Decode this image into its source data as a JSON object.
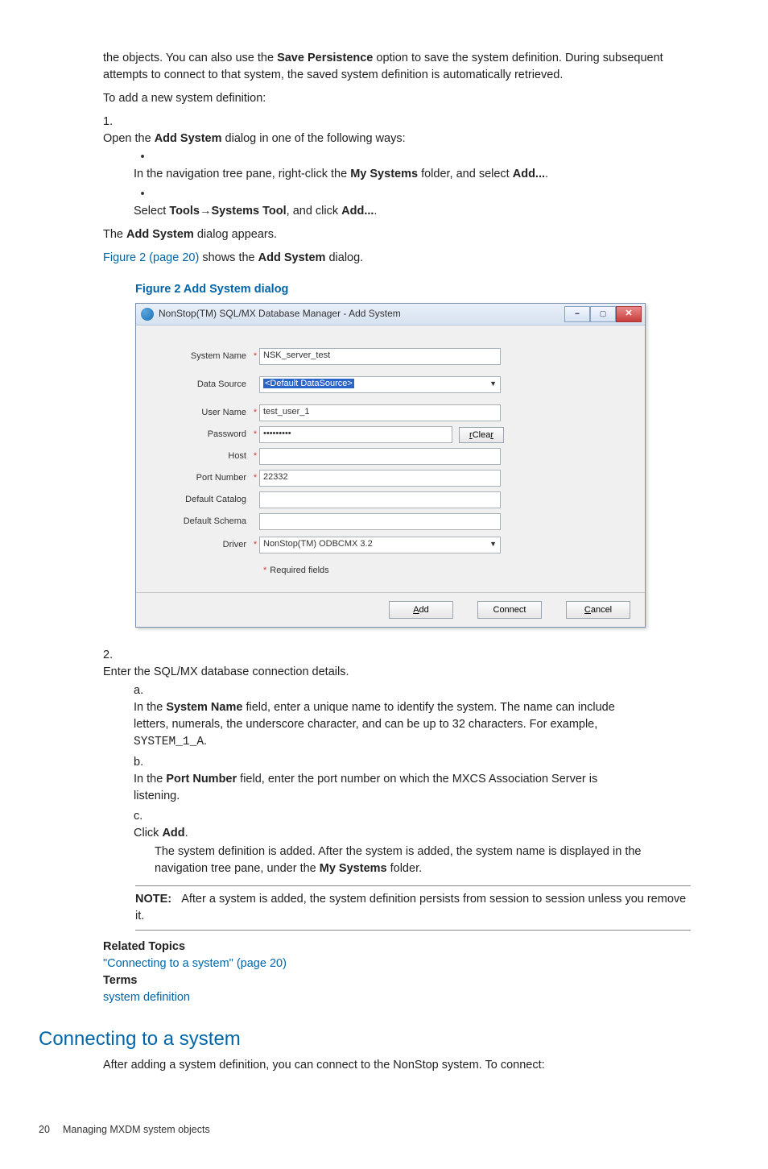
{
  "intro": {
    "p1a": "the objects. You can also use the ",
    "p1b": "Save Persistence",
    "p1c": " option to save the system definition. During subsequent attempts to connect to that system, the saved system definition is automatically retrieved.",
    "p2": "To add a new system definition:"
  },
  "step1": {
    "num": "1.",
    "text_a": "Open the ",
    "text_b": "Add System",
    "text_c": " dialog in one of the following ways:",
    "bullet1_a": "In the navigation tree pane, right-click the ",
    "bullet1_b": "My Systems",
    "bullet1_c": " folder, and select ",
    "bullet1_d": "Add...",
    "bullet1_e": ".",
    "bullet2_a": "Select ",
    "bullet2_b": "Tools",
    "bullet2_c": "→",
    "bullet2_d": "Systems Tool",
    "bullet2_e": ", and click ",
    "bullet2_f": "Add...",
    "bullet2_g": ".",
    "after1_a": "The ",
    "after1_b": "Add System",
    "after1_c": " dialog appears.",
    "after2_link": "Figure 2 (page 20)",
    "after2_a": " shows the ",
    "after2_b": "Add System",
    "after2_c": " dialog."
  },
  "figure": {
    "caption": "Figure 2 Add System dialog",
    "title": "NonStop(TM) SQL/MX Database Manager - Add System",
    "labels": {
      "system_name": "System Name",
      "data_source": "Data Source",
      "user_name": "User Name",
      "password": "Password",
      "host": "Host",
      "port_number": "Port Number",
      "default_catalog": "Default Catalog",
      "default_schema": "Default Schema",
      "driver": "Driver"
    },
    "values": {
      "system_name": "NSK_server_test",
      "data_source": "<Default DataSource>",
      "user_name": "test_user_1",
      "password": "•••••••••",
      "host": " ",
      "port_number": "22332",
      "default_catalog": "",
      "default_schema": "",
      "driver": "NonStop(TM) ODBCMX 3.2"
    },
    "clear": "Clear",
    "required_star": "*",
    "required_text": "Required fields",
    "buttons": {
      "add_u": "A",
      "add_r": "dd",
      "connect": "Connect",
      "cancel_u": "C",
      "cancel_r": "ancel"
    }
  },
  "step2": {
    "num": "2.",
    "text": "Enter the SQL/MX database connection details.",
    "a_letter": "a.",
    "a_a": "In the ",
    "a_b": "System Name",
    "a_c": " field, enter a unique name to identify the system. The name can include letters, numerals, the underscore character, and can be up to 32 characters. For example, ",
    "a_mono": "SYSTEM_1_A",
    "a_d": ".",
    "b_letter": "b.",
    "b_a": "In the ",
    "b_b": "Port Number",
    "b_c": " field, enter the port number on which the MXCS Association Server is listening.",
    "c_letter": "c.",
    "c_a": "Click ",
    "c_b": "Add",
    "c_c": ".",
    "c_body_a": "The system definition is added. After the system is added, the system name is displayed in the navigation tree pane, under the ",
    "c_body_b": "My Systems",
    "c_body_c": " folder."
  },
  "note": {
    "label": "NOTE:",
    "text": "After a system is added, the system definition persists from session to session unless you remove it."
  },
  "related": {
    "heading": "Related Topics",
    "link1": "\"Connecting to a system\" (page 20)",
    "terms": "Terms",
    "term1": "system definition"
  },
  "section2": {
    "heading": "Connecting to a system",
    "p1": "After adding a system definition, you can connect to the NonStop system. To connect:"
  },
  "footer": {
    "page": "20",
    "chapter": "Managing MXDM system objects"
  }
}
